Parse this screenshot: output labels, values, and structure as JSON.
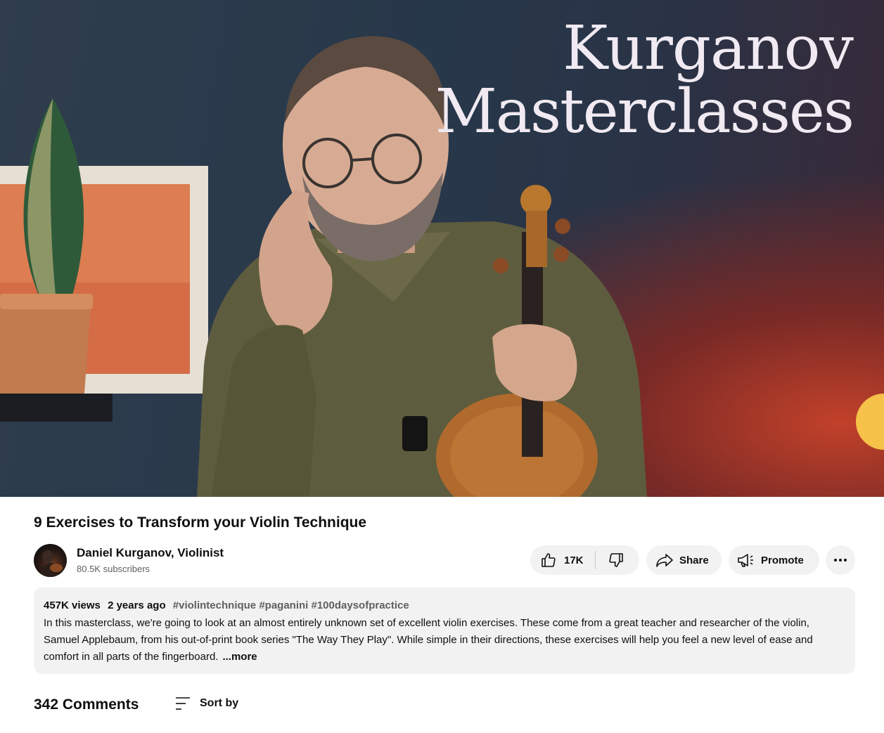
{
  "video": {
    "overlay_line1": "Kurganov",
    "overlay_line2": "Masterclasses",
    "title": "9 Exercises to Transform your Violin Technique"
  },
  "channel": {
    "name": "Daniel Kurganov, Violinist",
    "subscribers": "80.5K subscribers"
  },
  "actions": {
    "like_count": "17K",
    "like_icon": "thumbs-up-icon",
    "dislike_icon": "thumbs-down-icon",
    "share_label": "Share",
    "share_icon": "share-arrow-icon",
    "promote_label": "Promote",
    "promote_icon": "megaphone-icon",
    "more_icon": "more-horizontal-icon"
  },
  "description": {
    "views": "457K views",
    "age": "2 years ago",
    "tags": "#violintechnique #paganini #100daysofpractice",
    "text": "In this masterclass, we're going to look at an almost entirely unknown set of excellent violin exercises. These come from a great teacher and researcher of the violin, Samuel Applebaum, from his out-of-print book series \"The Way They Play\". While simple in their directions, these exercises will help you feel a new level of ease and comfort in all parts of the fingerboard.",
    "more_label": "...more"
  },
  "comments": {
    "count_label": "342 Comments",
    "sort_label": "Sort by",
    "sort_icon": "sort-lines-icon"
  },
  "colors": {
    "pill_bg": "#f2f2f2",
    "text_primary": "#0f0f0f",
    "text_secondary": "#606060"
  }
}
